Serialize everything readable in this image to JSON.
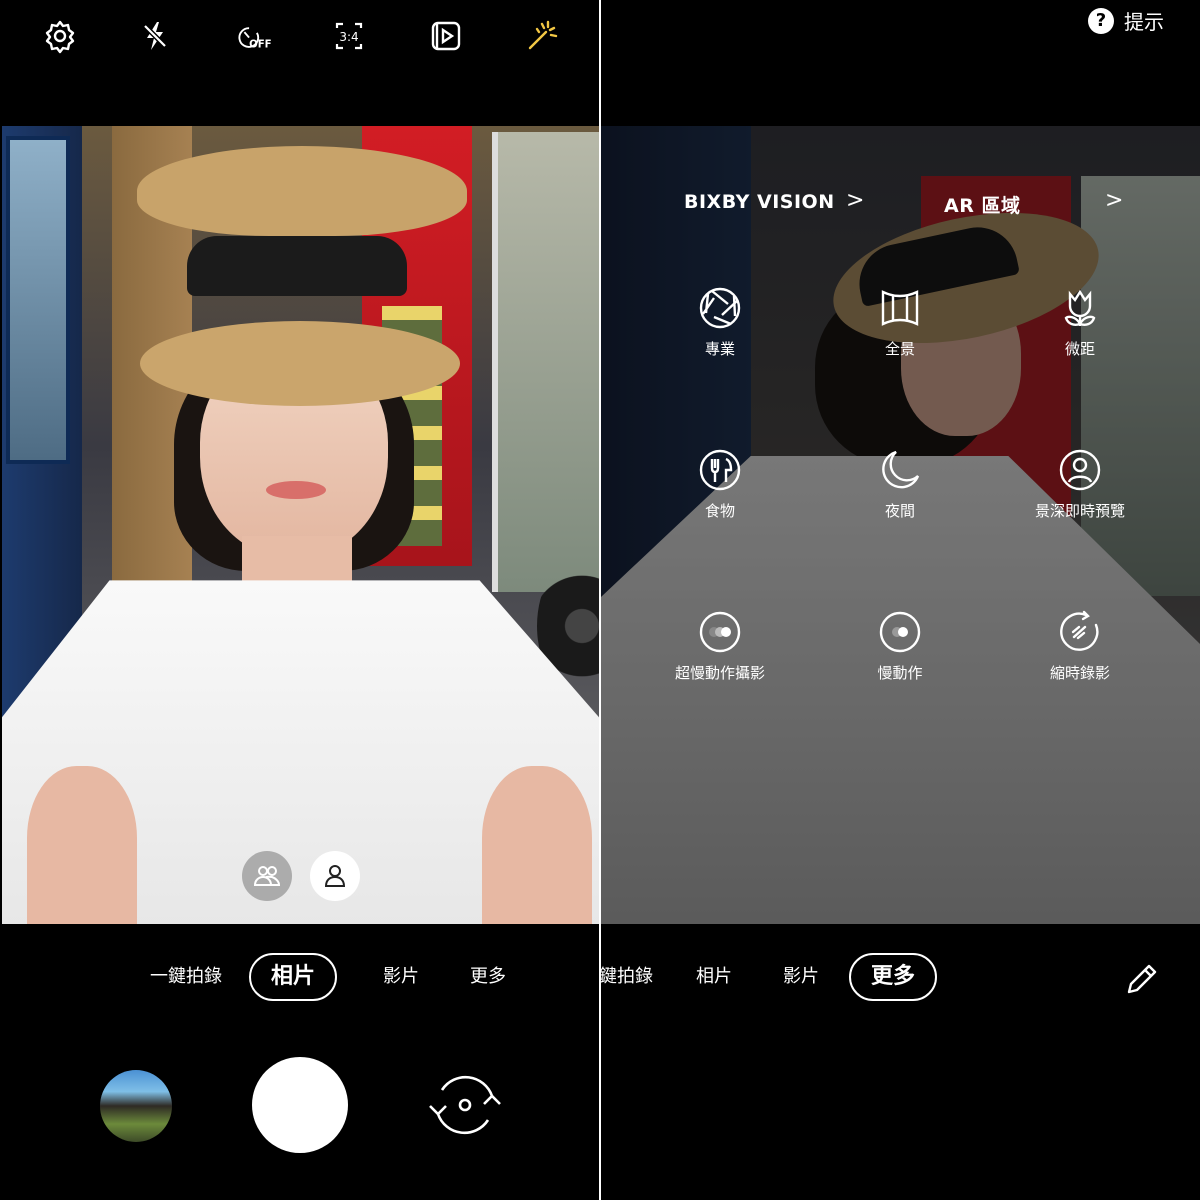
{
  "left_screen": {
    "toolbar": {
      "settings_icon": "gear-icon",
      "flash_icon": "flash-off-icon",
      "timer_label": "OFF",
      "ratio_label": "3:4",
      "motion_photo_icon": "motion-photo-icon",
      "filter_icon": "sparkle-icon",
      "accent_color": "#f2c744"
    },
    "viewfinder": {
      "group_toggle_icon": "group-people-icon",
      "single_toggle_icon": "single-person-icon"
    },
    "modes": [
      "一鍵拍錄",
      "相片",
      "影片",
      "更多"
    ],
    "selected_mode": "相片",
    "controls": {
      "gallery_thumbnail": "gallery-thumbnail",
      "shutter": "shutter-button",
      "switch_camera": "switch-camera-icon"
    }
  },
  "right_screen": {
    "hint": {
      "icon": "question-icon",
      "label": "提示"
    },
    "headers": [
      {
        "label": "BIXBY VISION",
        "chevron": ">"
      },
      {
        "label": "AR 區域",
        "chevron": ">"
      }
    ],
    "more_modes": [
      {
        "label": "專業",
        "icon": "aperture-icon"
      },
      {
        "label": "全景",
        "icon": "panorama-icon"
      },
      {
        "label": "微距",
        "icon": "tulip-icon"
      },
      {
        "label": "食物",
        "icon": "food-icon"
      },
      {
        "label": "夜間",
        "icon": "moon-icon"
      },
      {
        "label": "景深即時預覽",
        "icon": "portrait-icon"
      },
      {
        "label": "超慢動作攝影",
        "icon": "super-slow-icon"
      },
      {
        "label": "慢動作",
        "icon": "slow-motion-icon"
      },
      {
        "label": "縮時錄影",
        "icon": "hyperlapse-icon"
      }
    ],
    "modes": [
      "鍵拍錄",
      "相片",
      "影片",
      "更多"
    ],
    "selected_mode": "更多",
    "edit_icon": "pencil-icon"
  }
}
